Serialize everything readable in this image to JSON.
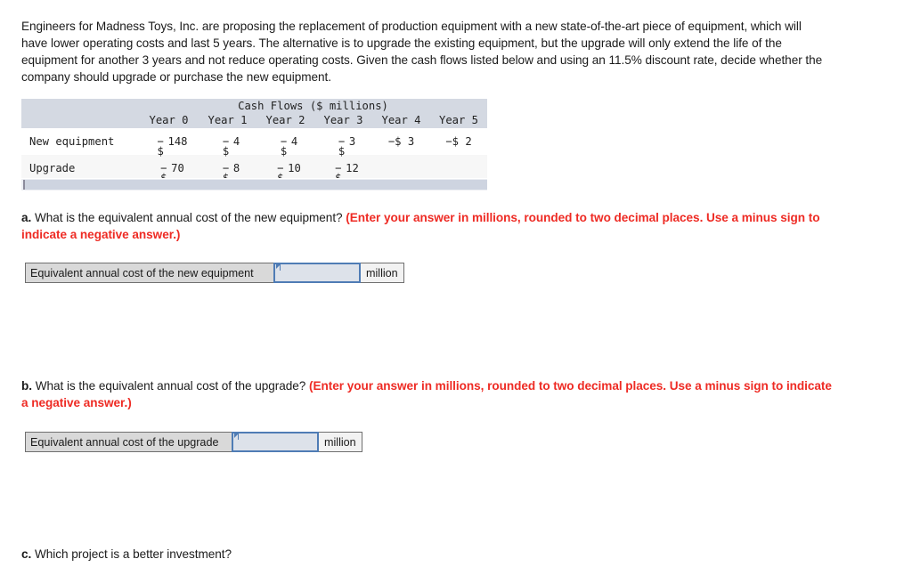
{
  "intro": {
    "paragraph": "Engineers for Madness Toys, Inc. are proposing the replacement of production equipment with a new state-of-the-art piece of equipment, which will have lower operating costs and last 5 years. The alternative is to upgrade the existing equipment, but the upgrade will only extend the life of the equipment for another 3 years and not reduce operating costs. Given the cash flows listed below and using an 11.5% discount rate, decide whether the company should upgrade or purchase the new equipment."
  },
  "table": {
    "title": "Cash Flows ($ millions)",
    "columns": [
      "",
      "Year 0",
      "Year 1",
      "Year 2",
      "Year 3",
      "Year 4",
      "Year 5"
    ],
    "rows": [
      {
        "label": "New equipment",
        "cells": [
          {
            "sign": "−",
            "currency": "$",
            "amount": "148",
            "wrapped": true
          },
          {
            "sign": "−",
            "currency": "$",
            "amount": "4",
            "wrapped": true
          },
          {
            "sign": "−",
            "currency": "$",
            "amount": "4",
            "wrapped": true
          },
          {
            "sign": "−",
            "currency": "$",
            "amount": "3",
            "wrapped": true
          },
          {
            "text": "−$ 3",
            "wrapped": false
          },
          {
            "text": "−$ 2",
            "wrapped": false
          }
        ]
      },
      {
        "label": "Upgrade",
        "cells": [
          {
            "sign": "−",
            "currency": "$",
            "amount": "70",
            "wrapped": true
          },
          {
            "sign": "−",
            "currency": "$",
            "amount": "8",
            "wrapped": true
          },
          {
            "sign": "−",
            "currency": "$",
            "amount": "10",
            "wrapped": true
          },
          {
            "sign": "−",
            "currency": "$",
            "amount": "12",
            "wrapped": true
          },
          {
            "text": "",
            "wrapped": false
          },
          {
            "text": "",
            "wrapped": false
          }
        ]
      }
    ]
  },
  "questions": {
    "a": {
      "marker": "a.",
      "text": " What is the equivalent annual cost of the new equipment? ",
      "hint": "(Enter your answer in millions, rounded to two decimal places. Use a minus sign to indicate a negative answer.)"
    },
    "b": {
      "marker": "b.",
      "text": " What is the equivalent annual cost of the upgrade? ",
      "hint": "(Enter your answer in millions, rounded to two decimal places. Use a minus sign to indicate a negative answer.)"
    },
    "c": {
      "marker": "c.",
      "text": " Which project is a better investment?",
      "hint": ""
    }
  },
  "answers": {
    "a": {
      "label": "Equivalent annual cost of the new equipment",
      "value": "",
      "placeholder": "",
      "unit": "million"
    },
    "b": {
      "label": "Equivalent annual cost of the upgrade",
      "value": "",
      "placeholder": "",
      "unit": "million"
    }
  },
  "colors": {
    "hint_red": "#ee2b24",
    "table_header_bg": "#d4d9e2",
    "input_border_blue": "#4f7cb5",
    "input_fill": "#dde2ea",
    "label_bg": "#d9d9d9"
  }
}
